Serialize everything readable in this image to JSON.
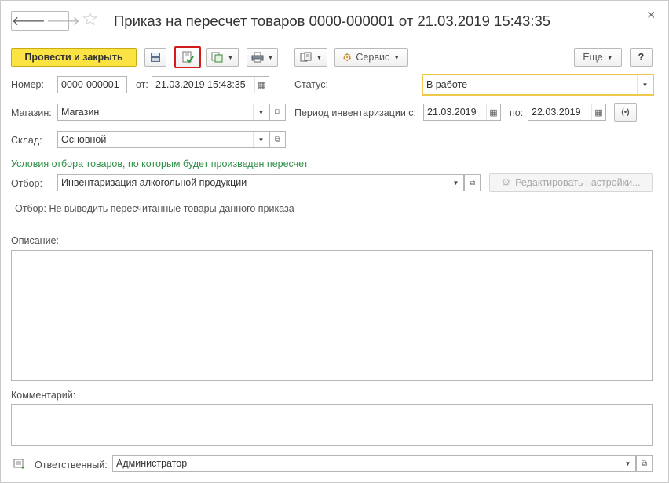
{
  "window": {
    "title": "Приказ на пересчет товаров 0000-000001 от 21.03.2019 15:43:35",
    "back_icon": "arrow-left-icon",
    "forward_icon": "arrow-right-icon",
    "star_icon": "star-icon",
    "close_glyph": "×"
  },
  "toolbar": {
    "post_close_label": "Провести и закрыть",
    "service_label": "Сервис",
    "more_label": "Еще",
    "help_label": "?"
  },
  "fields": {
    "number_label": "Номер:",
    "number_value": "0000-000001",
    "date_label": "от:",
    "date_value": "21.03.2019 15:43:35",
    "status_label": "Статус:",
    "status_value": "В работе",
    "store_label": "Магазин:",
    "store_value": "Магазин",
    "period_label": "Период инвентаризации с:",
    "period_from": "21.03.2019",
    "period_to_label": "по:",
    "period_to": "22.03.2019",
    "warehouse_label": "Склад:",
    "warehouse_value": "Основной",
    "conditions_text": "Условия отбора товаров, по которым будет произведен пересчет",
    "filter_label": "Отбор:",
    "filter_value": "Инвентаризация алкогольной продукции",
    "edit_settings_label": "Редактировать настройки...",
    "filter_note": "Отбор: Не выводить пересчитанные товары данного приказа",
    "description_label": "Описание:",
    "comment_label": "Комментарий:",
    "responsible_label": "Ответственный:",
    "responsible_value": "Администратор"
  },
  "colors": {
    "accent_yellow": "#FBE343",
    "highlight_red": "#D21C1C",
    "info_green": "#2E8F46"
  }
}
